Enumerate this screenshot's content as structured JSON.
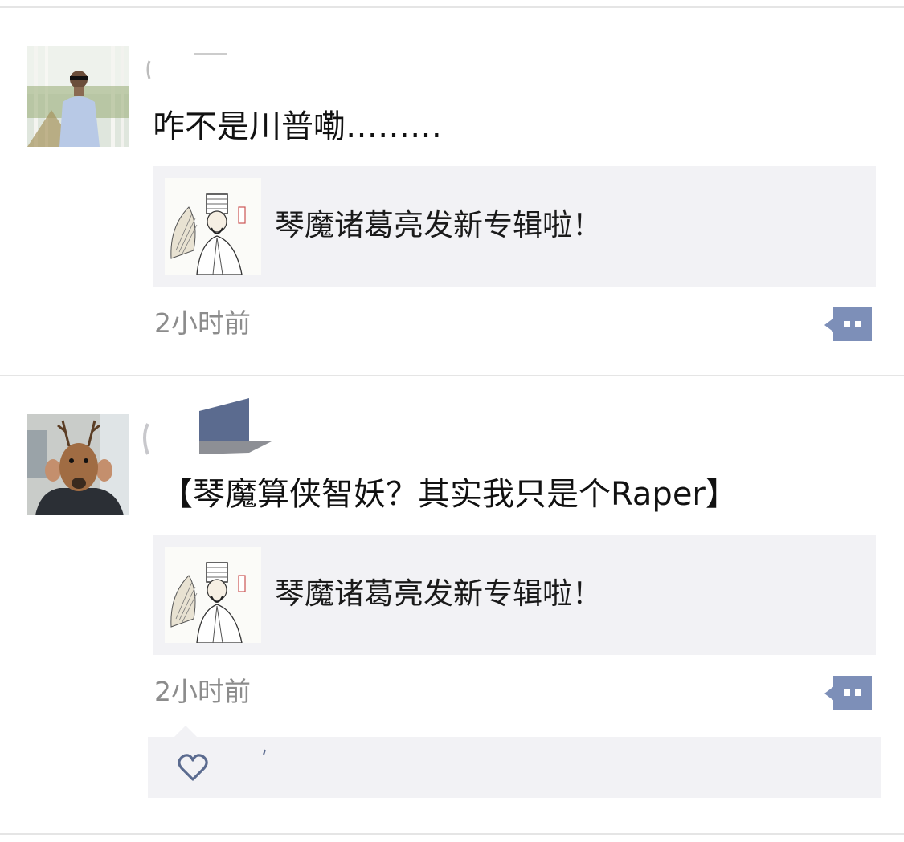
{
  "posts": [
    {
      "avatar": "avatar-person-snow-trees",
      "text": "咋不是川普嘞………",
      "link": {
        "title": "琴魔诸葛亮发新专辑啦！",
        "thumb_icon": "zhuge-liang-sketch"
      },
      "time": "2小时前",
      "comment_icon": "comment-bubble-icon"
    },
    {
      "avatar": "avatar-deer-mask",
      "text": "【琴魔算侠智妖？其实我只是个Raper】",
      "link": {
        "title": "琴魔诸葛亮发新专辑啦！",
        "thumb_icon": "zhuge-liang-sketch"
      },
      "time": "2小时前",
      "comment_icon": "comment-bubble-icon",
      "likes": {
        "icon": "heart-icon"
      }
    }
  ],
  "colors": {
    "accent": "#7d8fb8",
    "card_bg": "#f2f2f5",
    "timestamp": "#8c8c8c",
    "divider": "#e5e5e5"
  }
}
